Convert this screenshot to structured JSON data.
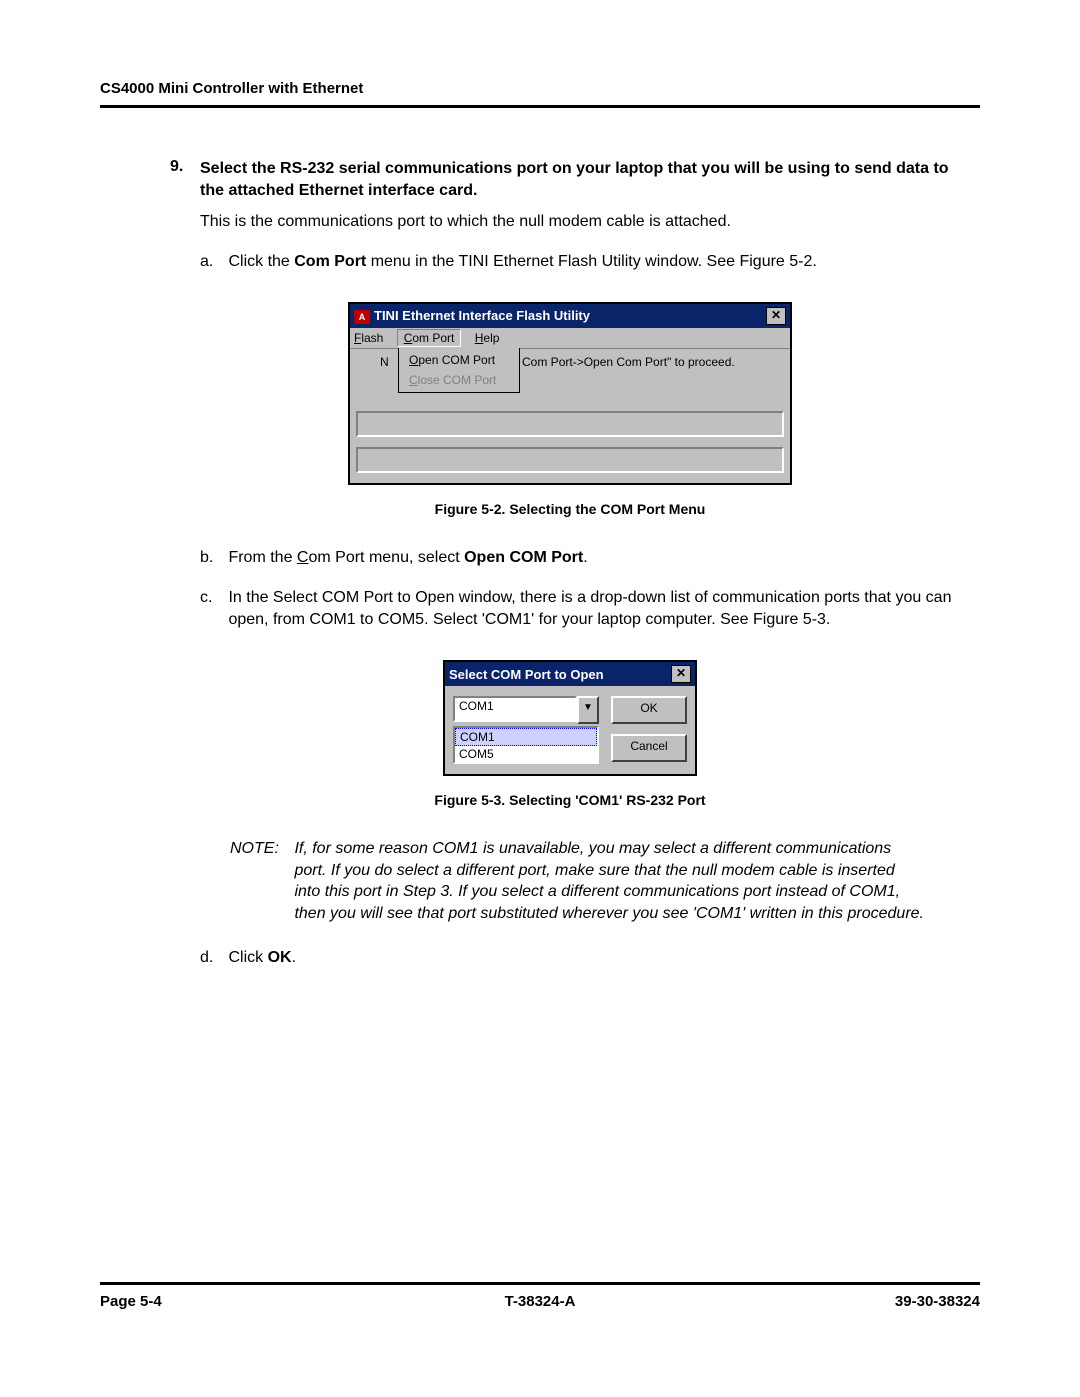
{
  "header": {
    "running_head": "CS4000 Mini Controller with Ethernet"
  },
  "step": {
    "number": "9.",
    "title_a": "Select the RS-232 serial communications port on your laptop that you will be using to send data to the attached Ethernet interface card.",
    "body": "This is the communications port to which the null modem cable is attached.",
    "a_lbl": "a.",
    "a_pre": "Click the ",
    "a_bold": "Com Port",
    "a_post": " menu in the TINI Ethernet Flash Utility window. See Figure 5-2.",
    "b_lbl": "b.",
    "b_pre": "From the ",
    "b_u": "C",
    "b_mid": "om Port menu, select ",
    "b_bold": "Open COM Port",
    "b_post": ".",
    "c_lbl": "c.",
    "c_text": "In the Select COM Port to Open window, there is a drop-down list of communication ports that you can open, from COM1 to COM5. Select 'COM1' for your laptop computer. See Figure 5-3.",
    "d_lbl": "d.",
    "d_pre": "Click ",
    "d_bold": "OK",
    "d_post": "."
  },
  "figcap1": "Figure 5-2.  Selecting the COM Port Menu",
  "figcap2": "Figure 5-3.  Selecting 'COM1' RS-232 Port",
  "note": {
    "label": "NOTE:",
    "text": "If, for some reason COM1 is unavailable, you may select a different communications port. If you do select a different port, make sure that the null modem cable is inserted into this port in Step 3. If you select a different communications port instead of COM1, then you will see that port substituted wherever you see 'COM1' written in this procedure."
  },
  "win1": {
    "title": "TINI Ethernet Interface Flash Utility",
    "menu": {
      "flash": "Flash",
      "comport": "Com Port",
      "help": "Help",
      "open": "Open COM Port",
      "close": "Close COM Port"
    },
    "msg": "Com Port->Open Com Port\" to proceed.",
    "close_x": "✕",
    "N": "N"
  },
  "win2": {
    "title": "Select COM Port to Open",
    "value": "COM1",
    "opt1": "COM1",
    "opt2": "COM5",
    "ok": "OK",
    "cancel": "Cancel",
    "arrow": "▼",
    "close_x": "✕"
  },
  "footer": {
    "left": "Page 5-4",
    "center": "T-38324-A",
    "right": "39-30-38324"
  }
}
